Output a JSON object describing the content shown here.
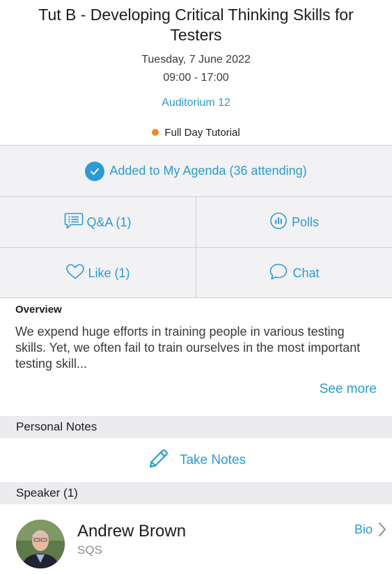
{
  "session": {
    "title": "Tut B - Developing Critical Thinking Skills for Testers",
    "date": "Tuesday, 7 June 2022",
    "time": "09:00 - 17:00",
    "location": "Auditorium 12",
    "track": "Full Day Tutorial",
    "track_color": "#f28a1b"
  },
  "agenda": {
    "label": "Added to My Agenda (36 attending)"
  },
  "actions": {
    "qa_label": "Q&A (1)",
    "polls_label": "Polls",
    "like_label": "Like (1)",
    "chat_label": "Chat"
  },
  "overview": {
    "heading": "Overview",
    "text": "We expend huge efforts in training people in various testing skills. Yet, we often fail to train ourselves in the most important testing skill...",
    "see_more": "See more"
  },
  "notes": {
    "section_label": "Personal Notes",
    "take_notes_label": "Take Notes"
  },
  "speakers": {
    "section_label": "Speaker (1)",
    "items": [
      {
        "name": "Andrew Brown",
        "org": "SQS",
        "bio_label": "Bio"
      }
    ]
  },
  "colors": {
    "accent": "#2a9bd6",
    "panel": "#f2f2f4",
    "section": "#ececef"
  }
}
